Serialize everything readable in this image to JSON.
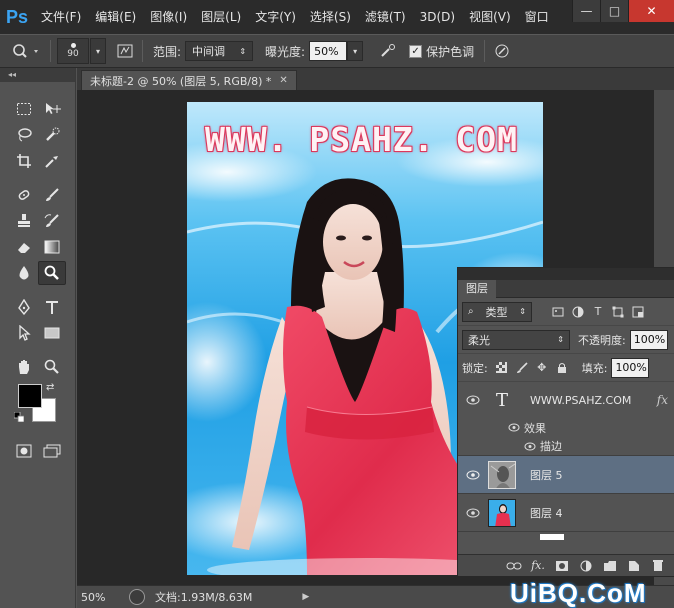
{
  "app": {
    "logo": "Ps",
    "menu": [
      "文件(F)",
      "编辑(E)",
      "图像(I)",
      "图层(L)",
      "文字(Y)",
      "选择(S)",
      "滤镜(T)",
      "3D(D)",
      "视图(V)",
      "窗口"
    ],
    "window_controls": {
      "minimize": "—",
      "maximize": "□",
      "close": "✕"
    }
  },
  "options_bar": {
    "brush_size": "90",
    "range_label": "范围:",
    "range_value": "中间调",
    "exposure_label": "曝光度:",
    "exposure_value": "50%",
    "protect_tones_label": "保护色调",
    "protect_tones_checked": true
  },
  "document": {
    "tab_title": "未标题-2 @ 50% (图层 5, RGB/8) *",
    "watermark_text": "WWW. PSAHZ. COM"
  },
  "status_bar": {
    "zoom": "50%",
    "doc_info": "文档:1.93M/8.63M"
  },
  "layers_panel": {
    "tab_label": "图层",
    "filter_type": "类型",
    "blend_mode": "柔光",
    "opacity_label": "不透明度:",
    "opacity_value": "100%",
    "lock_label": "锁定:",
    "fill_label": "填充:",
    "fill_value": "100%",
    "text_layer_name": "WWW.PSAHZ.COM",
    "fx_badge": "fx",
    "effects_label": "效果",
    "stroke_label": "描边",
    "layer5_name": "图层 5",
    "layer4_name": "图层 4",
    "footer_fx": "fx."
  },
  "site_watermark": "UiBQ.CoM",
  "colors": {
    "menubar_bg": "#2b2b2b",
    "panel_bg": "#535353",
    "canvas_bg": "#282828",
    "selected_layer": "#5e6f83",
    "close_button": "#c7372f",
    "ps_logo": "#3ba4f2",
    "dress_red": "#e8304f",
    "sea_blue": "#2ea6e6"
  },
  "icons": {
    "tools": [
      "marquee-icon",
      "move-icon",
      "lasso-icon",
      "quick-select-icon",
      "crop-icon",
      "eyedropper-icon",
      "healing-brush-icon",
      "brush-icon",
      "clone-stamp-icon",
      "history-brush-icon",
      "eraser-icon",
      "gradient-icon",
      "blur-icon",
      "dodge-icon",
      "pen-icon",
      "type-icon",
      "path-select-icon",
      "rectangle-icon",
      "hand-icon",
      "zoom-icon",
      "quick-mask-icon",
      "screen-mode-icon"
    ]
  }
}
